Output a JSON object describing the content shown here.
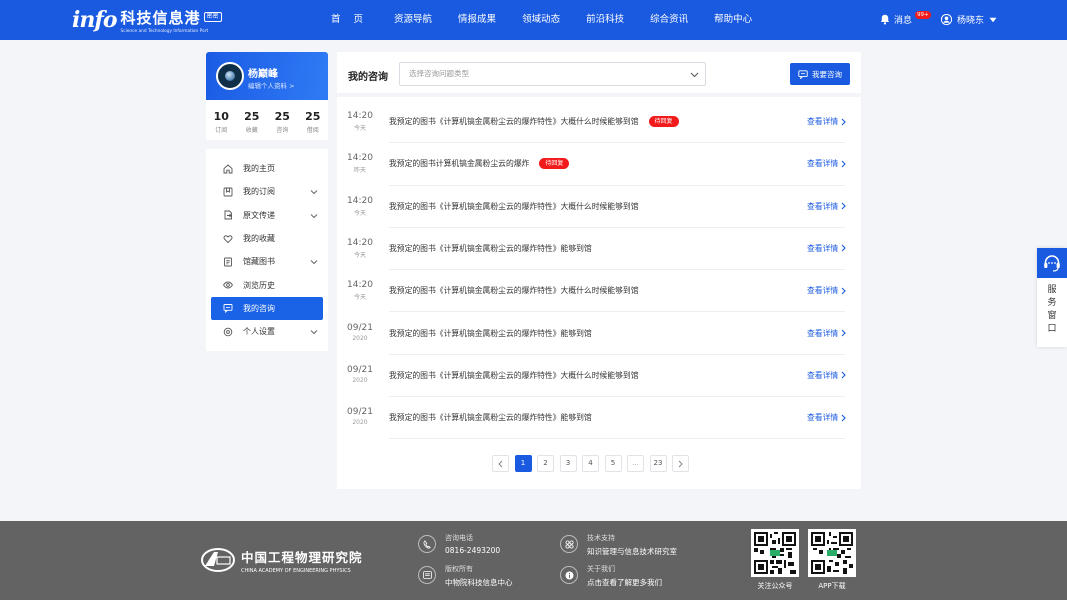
{
  "header": {
    "logo_mark": "info",
    "logo_cn": "科技信息港",
    "logo_badge": "密密",
    "logo_en": "Science and Technology Information Port",
    "nav": [
      "首 页",
      "资源导航",
      "情报成果",
      "领域动态",
      "前沿科技",
      "综合资讯",
      "帮助中心"
    ],
    "msg_label": "消息",
    "msg_badge": "99+",
    "user_name": "杨晓东"
  },
  "sidebar": {
    "profile_name": "杨巅峰",
    "profile_edit": "编辑个人资料 >",
    "stats": [
      {
        "num": "10",
        "label": "订阅"
      },
      {
        "num": "25",
        "label": "收藏"
      },
      {
        "num": "25",
        "label": "咨询"
      },
      {
        "num": "25",
        "label": "借阅"
      }
    ],
    "menu": [
      {
        "label": "我的主页",
        "icon": "home-icon",
        "chevron": false
      },
      {
        "label": "我的订阅",
        "icon": "bookmark-icon",
        "chevron": true
      },
      {
        "label": "原文传递",
        "icon": "transfer-icon",
        "chevron": true
      },
      {
        "label": "我的收藏",
        "icon": "heart-icon",
        "chevron": false
      },
      {
        "label": "馆藏图书",
        "icon": "book-icon",
        "chevron": true
      },
      {
        "label": "浏览历史",
        "icon": "eye-icon",
        "chevron": false
      },
      {
        "label": "我的咨询",
        "icon": "chat-icon",
        "chevron": false,
        "active": true
      },
      {
        "label": "个人设置",
        "icon": "settings-icon",
        "chevron": true
      }
    ]
  },
  "main": {
    "title": "我的咨询",
    "select_placeholder": "选择咨询问题类型",
    "ask_button": "我要咨询",
    "detail_label": "查看详情",
    "rows": [
      {
        "time": "14:20",
        "sub": "今天",
        "title": "我预定的图书《计算机镐金属粉尘云的爆炸特性》大概什么时候能够到馆",
        "tag": "待回复"
      },
      {
        "time": "14:20",
        "sub": "昨天",
        "title": "我预定的图书计算机镐金属粉尘云的爆炸",
        "tag": "待回复"
      },
      {
        "time": "14:20",
        "sub": "今天",
        "title": "我预定的图书《计算机镐金属粉尘云的爆炸特性》大概什么时候能够到馆",
        "tag": ""
      },
      {
        "time": "14:20",
        "sub": "今天",
        "title": "我预定的图书《计算机镐金属粉尘云的爆炸特性》能够到馆",
        "tag": ""
      },
      {
        "time": "14:20",
        "sub": "今天",
        "title": "我预定的图书《计算机镐金属粉尘云的爆炸特性》大概什么时候能够到馆",
        "tag": ""
      },
      {
        "time": "09/21",
        "sub": "2020",
        "title": "我预定的图书《计算机镐金属粉尘云的爆炸特性》能够到馆",
        "tag": ""
      },
      {
        "time": "09/21",
        "sub": "2020",
        "title": "我预定的图书《计算机镐金属粉尘云的爆炸特性》大概什么时候能够到馆",
        "tag": ""
      },
      {
        "time": "09/21",
        "sub": "2020",
        "title": "我预定的图书《计算机镐金属粉尘云的爆炸特性》能够到馆",
        "tag": ""
      }
    ],
    "pager": {
      "pages": [
        "1",
        "2",
        "3",
        "4",
        "5",
        "...",
        "23"
      ],
      "current": "1"
    }
  },
  "service": {
    "label": "服务窗口"
  },
  "footer": {
    "org_cn": "中国工程物理研究院",
    "org_en": "CHINA ACADEMY OF ENGINEERING PHYSICS",
    "phone_label": "咨询电话",
    "phone": "0816-2493200",
    "copyright_label": "版权所有",
    "copyright": "中物院科技信息中心",
    "support_label": "技术支持",
    "support": "知识管理与信息技术研究室",
    "about_label": "关于我们",
    "about": "点击查看了解更多我们",
    "qr1_label": "关注公众号",
    "qr2_label": "APP下载"
  },
  "colors": {
    "primary": "#1a5ae0",
    "tag": "#f21a1a",
    "footer": "#636363",
    "bg": "#f3f5f9"
  }
}
